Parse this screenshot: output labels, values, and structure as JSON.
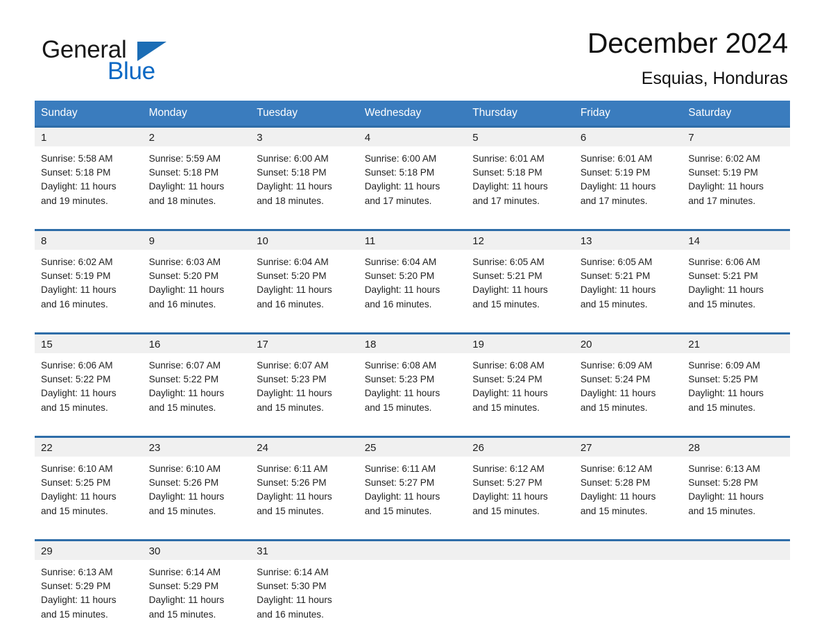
{
  "brand": {
    "name_top": "General",
    "name_bottom": "Blue",
    "triangle_color": "#1b6db5",
    "blue_text_color": "#0a68c4"
  },
  "header": {
    "title": "December 2024",
    "subtitle": "Esquias, Honduras"
  },
  "theme": {
    "header_bg": "#3a7cbe",
    "row_border": "#2e6da8",
    "daynum_bg": "#f0f0f0",
    "page_bg": "#ffffff",
    "text": "#1f1f1f"
  },
  "calendar": {
    "weekday_headers": [
      "Sunday",
      "Monday",
      "Tuesday",
      "Wednesday",
      "Thursday",
      "Friday",
      "Saturday"
    ],
    "weeks": [
      [
        {
          "day": "1",
          "sunrise": "Sunrise: 5:58 AM",
          "sunset": "Sunset: 5:18 PM",
          "daylight_line1": "Daylight: 11 hours",
          "daylight_line2": "and 19 minutes."
        },
        {
          "day": "2",
          "sunrise": "Sunrise: 5:59 AM",
          "sunset": "Sunset: 5:18 PM",
          "daylight_line1": "Daylight: 11 hours",
          "daylight_line2": "and 18 minutes."
        },
        {
          "day": "3",
          "sunrise": "Sunrise: 6:00 AM",
          "sunset": "Sunset: 5:18 PM",
          "daylight_line1": "Daylight: 11 hours",
          "daylight_line2": "and 18 minutes."
        },
        {
          "day": "4",
          "sunrise": "Sunrise: 6:00 AM",
          "sunset": "Sunset: 5:18 PM",
          "daylight_line1": "Daylight: 11 hours",
          "daylight_line2": "and 17 minutes."
        },
        {
          "day": "5",
          "sunrise": "Sunrise: 6:01 AM",
          "sunset": "Sunset: 5:18 PM",
          "daylight_line1": "Daylight: 11 hours",
          "daylight_line2": "and 17 minutes."
        },
        {
          "day": "6",
          "sunrise": "Sunrise: 6:01 AM",
          "sunset": "Sunset: 5:19 PM",
          "daylight_line1": "Daylight: 11 hours",
          "daylight_line2": "and 17 minutes."
        },
        {
          "day": "7",
          "sunrise": "Sunrise: 6:02 AM",
          "sunset": "Sunset: 5:19 PM",
          "daylight_line1": "Daylight: 11 hours",
          "daylight_line2": "and 17 minutes."
        }
      ],
      [
        {
          "day": "8",
          "sunrise": "Sunrise: 6:02 AM",
          "sunset": "Sunset: 5:19 PM",
          "daylight_line1": "Daylight: 11 hours",
          "daylight_line2": "and 16 minutes."
        },
        {
          "day": "9",
          "sunrise": "Sunrise: 6:03 AM",
          "sunset": "Sunset: 5:20 PM",
          "daylight_line1": "Daylight: 11 hours",
          "daylight_line2": "and 16 minutes."
        },
        {
          "day": "10",
          "sunrise": "Sunrise: 6:04 AM",
          "sunset": "Sunset: 5:20 PM",
          "daylight_line1": "Daylight: 11 hours",
          "daylight_line2": "and 16 minutes."
        },
        {
          "day": "11",
          "sunrise": "Sunrise: 6:04 AM",
          "sunset": "Sunset: 5:20 PM",
          "daylight_line1": "Daylight: 11 hours",
          "daylight_line2": "and 16 minutes."
        },
        {
          "day": "12",
          "sunrise": "Sunrise: 6:05 AM",
          "sunset": "Sunset: 5:21 PM",
          "daylight_line1": "Daylight: 11 hours",
          "daylight_line2": "and 15 minutes."
        },
        {
          "day": "13",
          "sunrise": "Sunrise: 6:05 AM",
          "sunset": "Sunset: 5:21 PM",
          "daylight_line1": "Daylight: 11 hours",
          "daylight_line2": "and 15 minutes."
        },
        {
          "day": "14",
          "sunrise": "Sunrise: 6:06 AM",
          "sunset": "Sunset: 5:21 PM",
          "daylight_line1": "Daylight: 11 hours",
          "daylight_line2": "and 15 minutes."
        }
      ],
      [
        {
          "day": "15",
          "sunrise": "Sunrise: 6:06 AM",
          "sunset": "Sunset: 5:22 PM",
          "daylight_line1": "Daylight: 11 hours",
          "daylight_line2": "and 15 minutes."
        },
        {
          "day": "16",
          "sunrise": "Sunrise: 6:07 AM",
          "sunset": "Sunset: 5:22 PM",
          "daylight_line1": "Daylight: 11 hours",
          "daylight_line2": "and 15 minutes."
        },
        {
          "day": "17",
          "sunrise": "Sunrise: 6:07 AM",
          "sunset": "Sunset: 5:23 PM",
          "daylight_line1": "Daylight: 11 hours",
          "daylight_line2": "and 15 minutes."
        },
        {
          "day": "18",
          "sunrise": "Sunrise: 6:08 AM",
          "sunset": "Sunset: 5:23 PM",
          "daylight_line1": "Daylight: 11 hours",
          "daylight_line2": "and 15 minutes."
        },
        {
          "day": "19",
          "sunrise": "Sunrise: 6:08 AM",
          "sunset": "Sunset: 5:24 PM",
          "daylight_line1": "Daylight: 11 hours",
          "daylight_line2": "and 15 minutes."
        },
        {
          "day": "20",
          "sunrise": "Sunrise: 6:09 AM",
          "sunset": "Sunset: 5:24 PM",
          "daylight_line1": "Daylight: 11 hours",
          "daylight_line2": "and 15 minutes."
        },
        {
          "day": "21",
          "sunrise": "Sunrise: 6:09 AM",
          "sunset": "Sunset: 5:25 PM",
          "daylight_line1": "Daylight: 11 hours",
          "daylight_line2": "and 15 minutes."
        }
      ],
      [
        {
          "day": "22",
          "sunrise": "Sunrise: 6:10 AM",
          "sunset": "Sunset: 5:25 PM",
          "daylight_line1": "Daylight: 11 hours",
          "daylight_line2": "and 15 minutes."
        },
        {
          "day": "23",
          "sunrise": "Sunrise: 6:10 AM",
          "sunset": "Sunset: 5:26 PM",
          "daylight_line1": "Daylight: 11 hours",
          "daylight_line2": "and 15 minutes."
        },
        {
          "day": "24",
          "sunrise": "Sunrise: 6:11 AM",
          "sunset": "Sunset: 5:26 PM",
          "daylight_line1": "Daylight: 11 hours",
          "daylight_line2": "and 15 minutes."
        },
        {
          "day": "25",
          "sunrise": "Sunrise: 6:11 AM",
          "sunset": "Sunset: 5:27 PM",
          "daylight_line1": "Daylight: 11 hours",
          "daylight_line2": "and 15 minutes."
        },
        {
          "day": "26",
          "sunrise": "Sunrise: 6:12 AM",
          "sunset": "Sunset: 5:27 PM",
          "daylight_line1": "Daylight: 11 hours",
          "daylight_line2": "and 15 minutes."
        },
        {
          "day": "27",
          "sunrise": "Sunrise: 6:12 AM",
          "sunset": "Sunset: 5:28 PM",
          "daylight_line1": "Daylight: 11 hours",
          "daylight_line2": "and 15 minutes."
        },
        {
          "day": "28",
          "sunrise": "Sunrise: 6:13 AM",
          "sunset": "Sunset: 5:28 PM",
          "daylight_line1": "Daylight: 11 hours",
          "daylight_line2": "and 15 minutes."
        }
      ],
      [
        {
          "day": "29",
          "sunrise": "Sunrise: 6:13 AM",
          "sunset": "Sunset: 5:29 PM",
          "daylight_line1": "Daylight: 11 hours",
          "daylight_line2": "and 15 minutes."
        },
        {
          "day": "30",
          "sunrise": "Sunrise: 6:14 AM",
          "sunset": "Sunset: 5:29 PM",
          "daylight_line1": "Daylight: 11 hours",
          "daylight_line2": "and 15 minutes."
        },
        {
          "day": "31",
          "sunrise": "Sunrise: 6:14 AM",
          "sunset": "Sunset: 5:30 PM",
          "daylight_line1": "Daylight: 11 hours",
          "daylight_line2": "and 16 minutes."
        },
        {
          "day": "",
          "sunrise": "",
          "sunset": "",
          "daylight_line1": "",
          "daylight_line2": ""
        },
        {
          "day": "",
          "sunrise": "",
          "sunset": "",
          "daylight_line1": "",
          "daylight_line2": ""
        },
        {
          "day": "",
          "sunrise": "",
          "sunset": "",
          "daylight_line1": "",
          "daylight_line2": ""
        },
        {
          "day": "",
          "sunrise": "",
          "sunset": "",
          "daylight_line1": "",
          "daylight_line2": ""
        }
      ]
    ]
  }
}
